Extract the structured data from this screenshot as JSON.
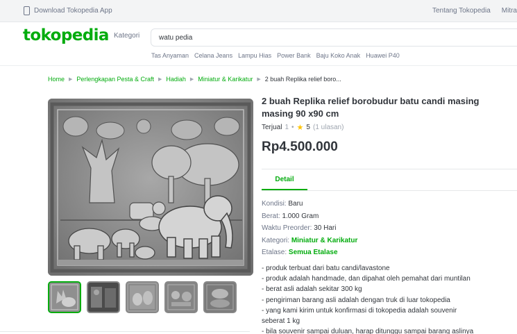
{
  "topbar": {
    "download_label": "Download Tokopedia App",
    "links": [
      "Tentang Tokopedia",
      "Mitra"
    ]
  },
  "header": {
    "logo": "tokopedia",
    "kategori_label": "Kategori",
    "search_value": "watu pedia",
    "suggestions": [
      "Tas Anyaman",
      "Celana Jeans",
      "Lampu Hias",
      "Power Bank",
      "Baju Koko Anak",
      "Huawei P40"
    ]
  },
  "breadcrumb": [
    "Home",
    "Perlengkapan Pesta & Craft",
    "Hadiah",
    "Miniatur & Karikatur",
    "2 buah Replika relief boro..."
  ],
  "product": {
    "title": "2 buah Replika relief borobudur batu candi masing masing 90 x90 cm",
    "sold_label": "Terjual",
    "sold_count": "1",
    "dot": "•",
    "rating": "5",
    "reviews": "(1 ulasan)",
    "price": "Rp4.500.000",
    "tab_detail": "Detail",
    "specs": [
      {
        "label": "Kondisi:",
        "value": "Baru"
      },
      {
        "label": "Berat:",
        "value": "1.000 Gram"
      },
      {
        "label": "Waktu Preorder:",
        "value": "30 Hari"
      },
      {
        "label": "Kategori:",
        "value": "Miniatur & Karikatur"
      },
      {
        "label": "Etalase:",
        "value": "Semua Etalase"
      }
    ],
    "description": [
      "- produk terbuat dari batu candi/lavastone",
      "- produk adalah handmade, dan dipahat oleh pemahat dari muntilan",
      "- berat asli adalah sekitar 300 kg",
      "- pengiriman barang asli adalah dengan truk di luar tokopedia",
      "- yang kami kirim untuk konfirmasi di tokopedia adalah souvenir",
      "seberat 1 kg",
      "- bila souvenir sampai duluan, harap ditunggu sampai barang aslinya"
    ]
  },
  "colors": {
    "brand_green": "#03ac0e",
    "star": "#ffc400",
    "relief_stone": "#8e8e8e"
  },
  "icons": [
    "phone-icon",
    "chevron-right-icon",
    "star-icon"
  ]
}
